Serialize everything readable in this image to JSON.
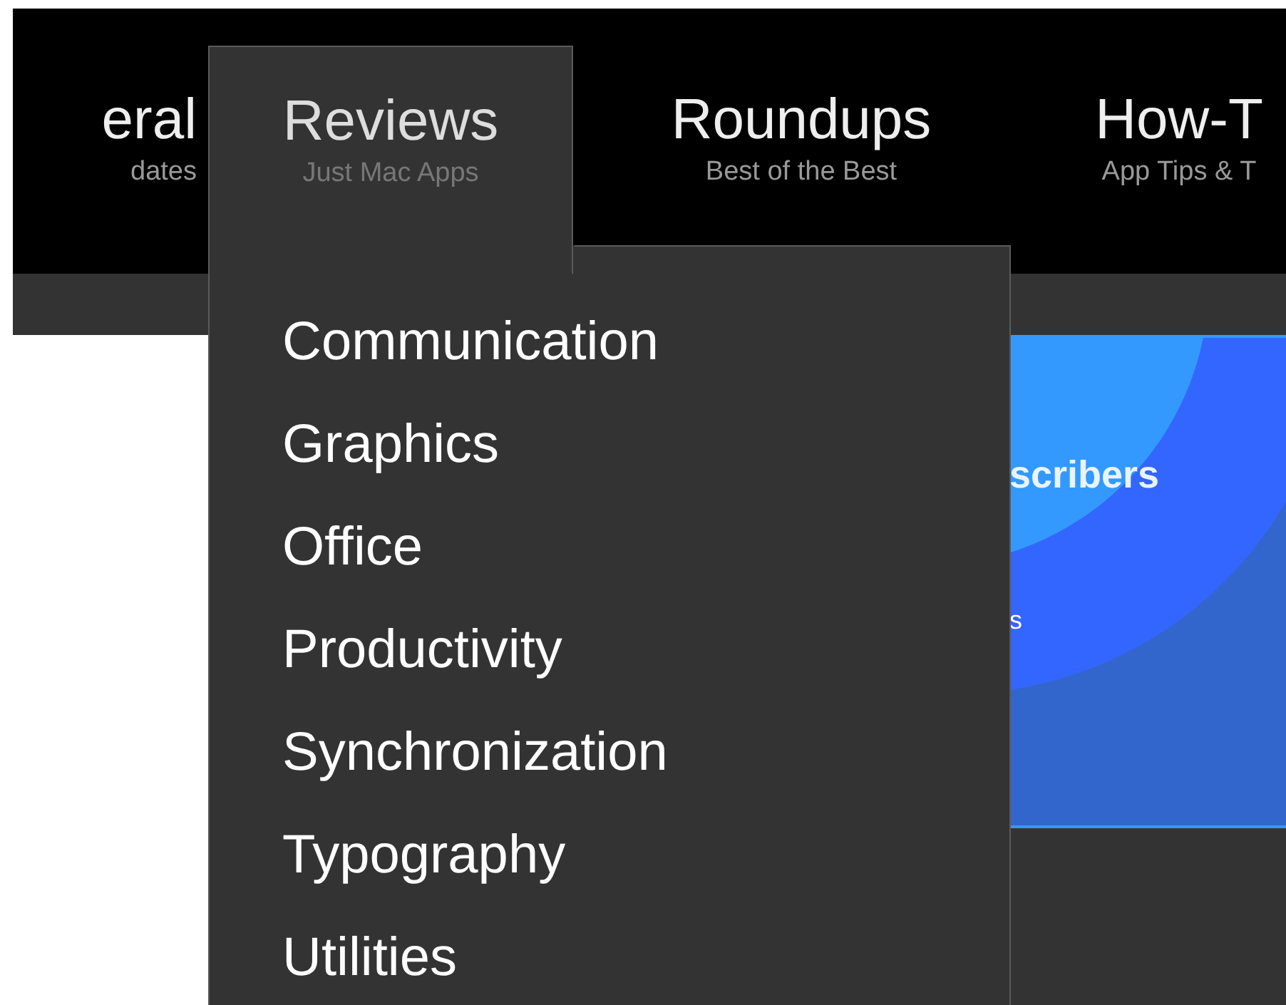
{
  "nav": [
    {
      "title": "eral",
      "subtitle": "dates",
      "selected": false
    },
    {
      "title": "Reviews",
      "subtitle": "Just Mac Apps",
      "selected": true
    },
    {
      "title": "Roundups",
      "subtitle": "Best of the Best",
      "selected": false
    },
    {
      "title": "How-T",
      "subtitle": "App Tips & T",
      "selected": false
    }
  ],
  "dropdown": {
    "items": [
      "Communication",
      "Graphics",
      "Office",
      "Productivity",
      "Synchronization",
      "Typography",
      "Utilities"
    ]
  },
  "banner": {
    "heading": "scribers",
    "line": "s"
  }
}
